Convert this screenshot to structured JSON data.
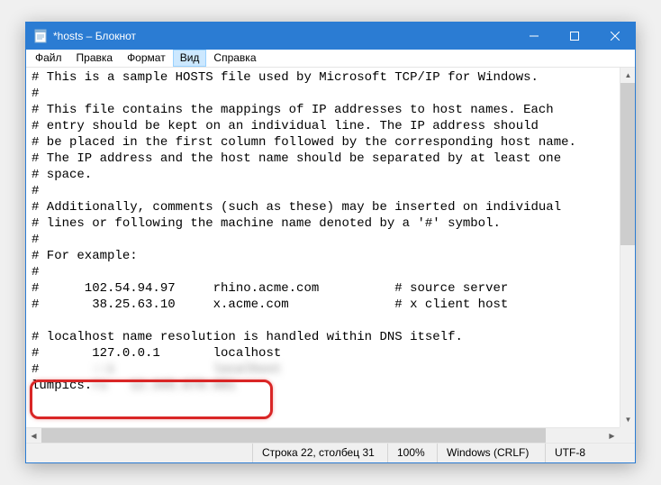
{
  "titlebar": {
    "title": "*hosts – Блокнот"
  },
  "menu": {
    "file": "Файл",
    "edit": "Правка",
    "format": "Формат",
    "view": "Вид",
    "help": "Справка"
  },
  "content": {
    "lines": [
      "# This is a sample HOSTS file used by Microsoft TCP/IP for Windows.",
      "#",
      "# This file contains the mappings of IP addresses to host names. Each",
      "# entry should be kept on an individual line. The IP address should",
      "# be placed in the first column followed by the corresponding host name.",
      "# The IP address and the host name should be separated by at least one",
      "# space.",
      "#",
      "# Additionally, comments (such as these) may be inserted on individual",
      "# lines or following the machine name denoted by a '#' symbol.",
      "#",
      "# For example:",
      "#",
      "#      102.54.94.97     rhino.acme.com          # source server",
      "#       38.25.63.10     x.acme.com              # x client host",
      "",
      "# localhost name resolution is handled within DNS itself.",
      "#       127.0.0.1       localhost"
    ],
    "blurred_prefix_a": "#       ",
    "blurred_a": "::1             localhost",
    "entry_prefix": "lumpics.",
    "entry_blurred": "ru   12.345.678.901"
  },
  "status": {
    "position": "Строка 22, столбец 31",
    "zoom": "100%",
    "lineending": "Windows (CRLF)",
    "encoding": "UTF-8"
  }
}
